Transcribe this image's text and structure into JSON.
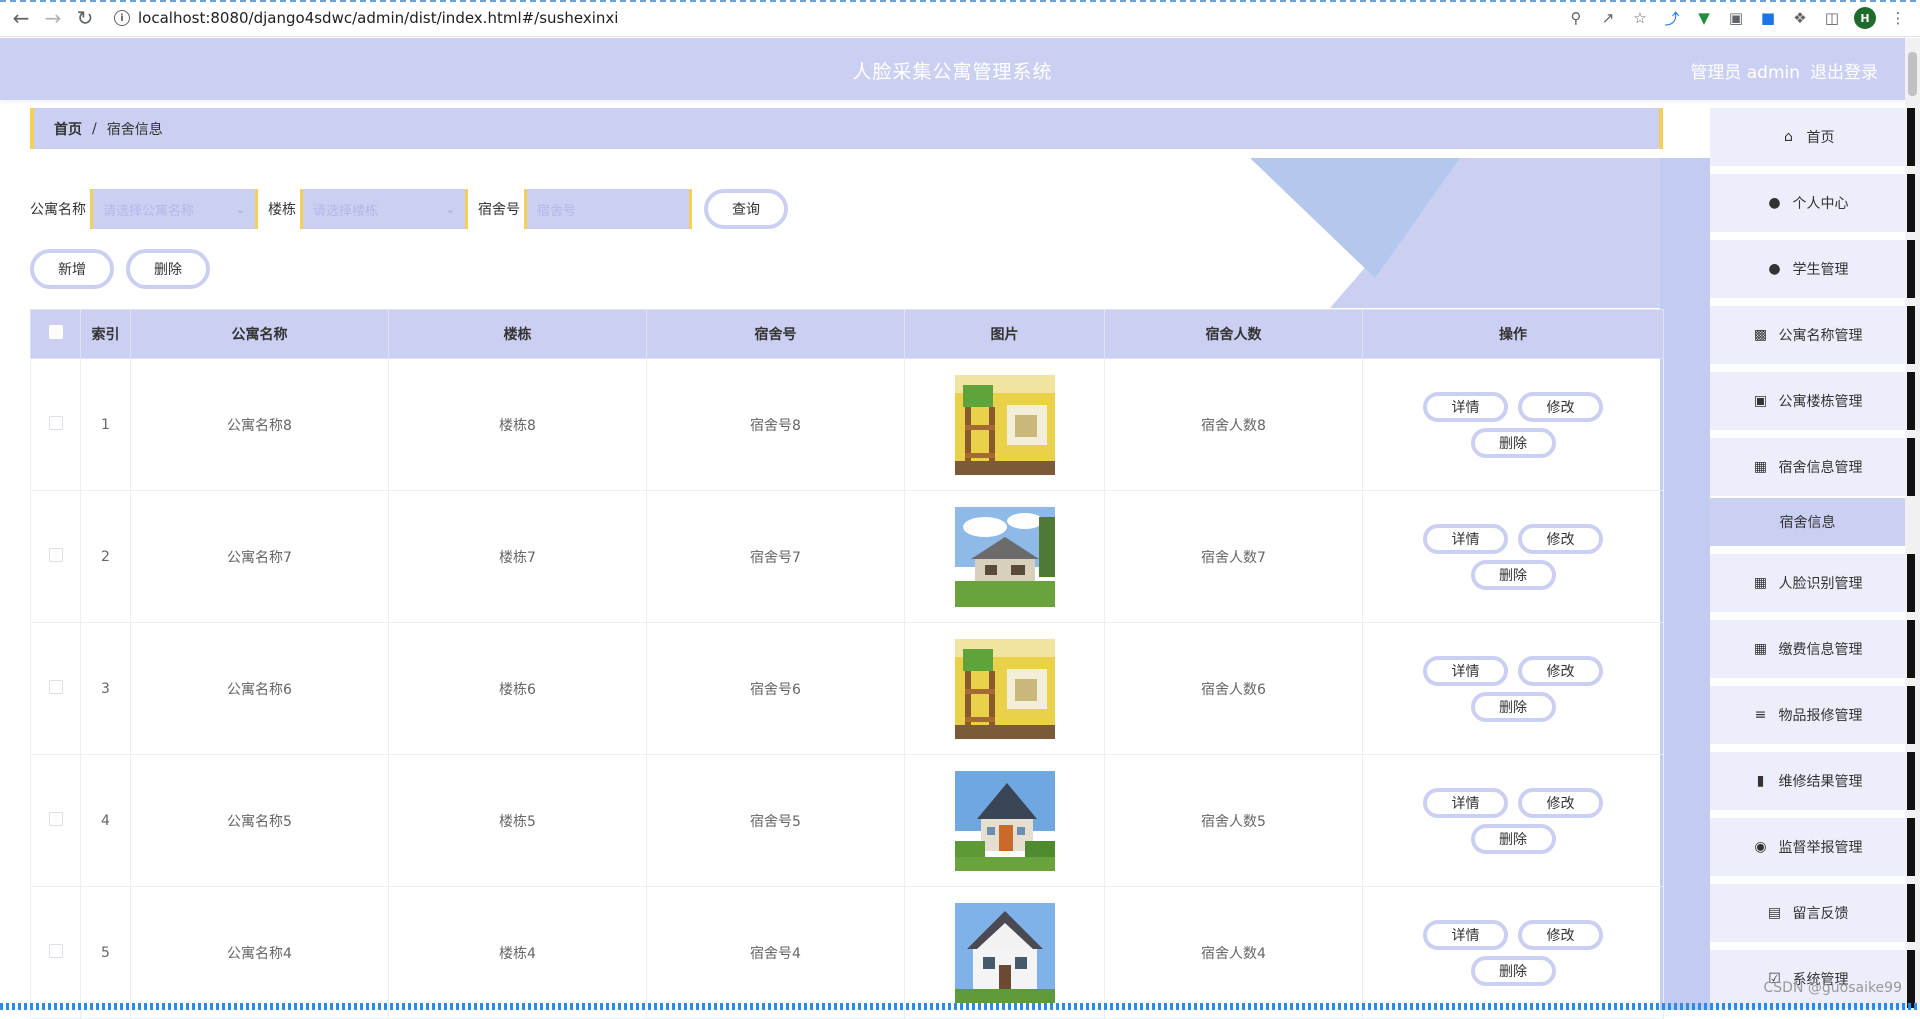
{
  "browser": {
    "url": "localhost:8080/django4sdwc/admin/dist/index.html#/sushexinxi",
    "back_icon": "arrow-left-icon",
    "forward_icon": "arrow-right-icon",
    "reload_icon": "reload-icon",
    "avatar_letter": "H"
  },
  "header": {
    "title": "人脸采集公寓管理系统",
    "user_label": "管理员 admin",
    "logout_label": "退出登录"
  },
  "breadcrumb": {
    "home": "首页",
    "separator": "/",
    "current": "宿舍信息"
  },
  "search": {
    "apartment_label": "公寓名称",
    "apartment_placeholder": "请选择公寓名称",
    "building_label": "楼栋",
    "building_placeholder": "请选择楼栋",
    "room_label": "宿舍号",
    "room_placeholder": "宿舍号",
    "query_button": "查询"
  },
  "actions": {
    "add_button": "新增",
    "delete_button": "删除"
  },
  "table": {
    "headers": {
      "index": "索引",
      "apartment": "公寓名称",
      "building": "楼栋",
      "room": "宿舍号",
      "image": "图片",
      "count": "宿舍人数",
      "operation": "操作"
    },
    "row_buttons": {
      "detail": "详情",
      "edit": "修改",
      "delete": "删除"
    },
    "rows": [
      {
        "index": "1",
        "apartment": "公寓名称8",
        "building": "楼栋8",
        "room": "宿舍号8",
        "count": "宿舍人数8",
        "image": "bunk-room"
      },
      {
        "index": "2",
        "apartment": "公寓名称7",
        "building": "楼栋7",
        "room": "宿舍号7",
        "count": "宿舍人数7",
        "image": "house-garden"
      },
      {
        "index": "3",
        "apartment": "公寓名称6",
        "building": "楼栋6",
        "room": "宿舍号6",
        "count": "宿舍人数6",
        "image": "bunk-room"
      },
      {
        "index": "4",
        "apartment": "公寓名称5",
        "building": "楼栋5",
        "room": "宿舍号5",
        "count": "宿舍人数5",
        "image": "house-solar"
      },
      {
        "index": "5",
        "apartment": "公寓名称4",
        "building": "楼栋4",
        "room": "宿舍号4",
        "count": "宿舍人数4",
        "image": "house-gable"
      }
    ]
  },
  "sidebar": {
    "items": [
      {
        "label": "首页",
        "icon": "home-icon"
      },
      {
        "label": "个人中心",
        "icon": "user-icon"
      },
      {
        "label": "学生管理",
        "icon": "user-icon"
      },
      {
        "label": "公寓名称管理",
        "icon": "chat-icon"
      },
      {
        "label": "公寓楼栋管理",
        "icon": "briefcase-icon"
      },
      {
        "label": "宿舍信息管理",
        "icon": "grid-icon"
      },
      {
        "label": "人脸识别管理",
        "icon": "grid-icon"
      },
      {
        "label": "缴费信息管理",
        "icon": "grid-icon"
      },
      {
        "label": "物品报修管理",
        "icon": "sliders-icon"
      },
      {
        "label": "维修结果管理",
        "icon": "book-icon"
      },
      {
        "label": "监督举报管理",
        "icon": "pin-icon"
      },
      {
        "label": "留言反馈",
        "icon": "clipboard-icon"
      },
      {
        "label": "系统管理",
        "icon": "clipboard-check-icon"
      }
    ],
    "active_sub": "宿舍信息"
  },
  "watermark": "CSDN @guosaike99",
  "colors": {
    "theme": "#cbd0f3",
    "accent_border": "#f4cf5a",
    "header_text": "#ffffff"
  }
}
